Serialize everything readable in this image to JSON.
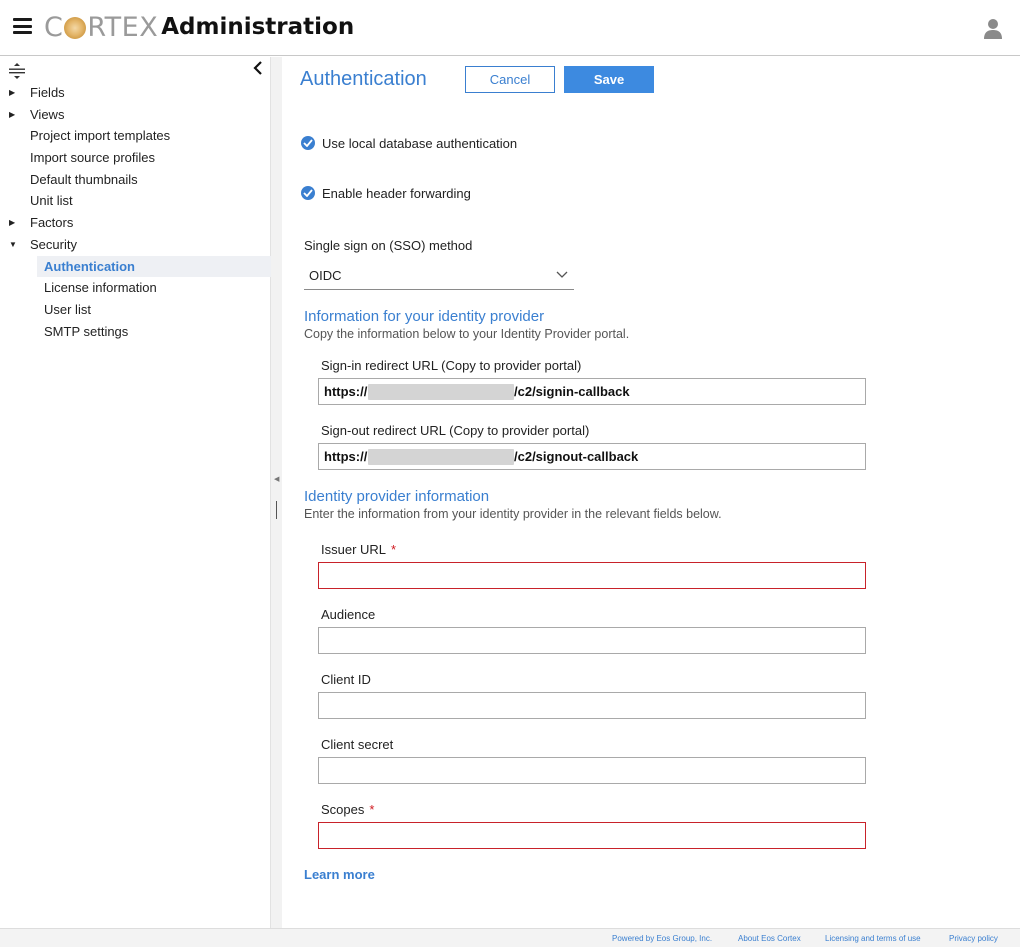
{
  "header": {
    "logo_text_left": "C",
    "logo_text_right": "RTEX",
    "app_title": "Administration"
  },
  "sidebar": {
    "items": [
      {
        "label": "Fields",
        "expandable": "collapsed"
      },
      {
        "label": "Views",
        "expandable": "collapsed"
      },
      {
        "label": "Project import templates"
      },
      {
        "label": "Import source profiles"
      },
      {
        "label": "Default thumbnails"
      },
      {
        "label": "Unit list"
      },
      {
        "label": "Factors",
        "expandable": "collapsed"
      },
      {
        "label": "Security",
        "expandable": "expanded"
      },
      {
        "label": "Authentication",
        "active": true,
        "level": 2
      },
      {
        "label": "License information",
        "level": 2
      },
      {
        "label": "User list",
        "level": 2
      },
      {
        "label": "SMTP settings",
        "level": 2
      }
    ]
  },
  "main": {
    "title": "Authentication",
    "cancel_label": "Cancel",
    "save_label": "Save",
    "local_db_label": "Use local database authentication",
    "header_forwarding_label": "Enable header forwarding",
    "sso_label": "Single sign on (SSO) method",
    "sso_value": "OIDC",
    "info_section_title": "Information for your identity provider",
    "info_section_desc": "Copy the information below to your Identity Provider portal.",
    "signin_label": "Sign-in redirect URL (Copy to provider portal)",
    "signin_prefix": "https://",
    "signin_suffix": "/c2/signin-callback",
    "signout_label": "Sign-out redirect URL (Copy to provider portal)",
    "signout_prefix": "https://",
    "signout_suffix": "/c2/signout-callback",
    "idp_section_title": "Identity provider information",
    "idp_section_desc": "Enter the information from your identity provider in the relevant fields below.",
    "issuer_label": "Issuer URL",
    "issuer_value": "",
    "audience_label": "Audience",
    "audience_value": "",
    "client_id_label": "Client ID",
    "client_id_value": "",
    "client_secret_label": "Client secret",
    "client_secret_value": "",
    "scopes_label": "Scopes",
    "scopes_value": "",
    "required_mark": "*",
    "learn_more": "Learn more"
  },
  "footer": {
    "powered_by": "Powered by Eos Group, Inc.",
    "about": "About Eos Cortex",
    "licensing": "Licensing and terms of use",
    "privacy": "Privacy policy"
  },
  "colors": {
    "accent": "#3a7fd0",
    "error_border": "#c8222a",
    "logo_gold": "#d9a552"
  },
  "icons": [
    "hamburger-menu-icon",
    "user-account-icon",
    "expand-collapse-all-icon",
    "chevron-left-icon",
    "check-circle-icon",
    "chevron-down-icon"
  ]
}
